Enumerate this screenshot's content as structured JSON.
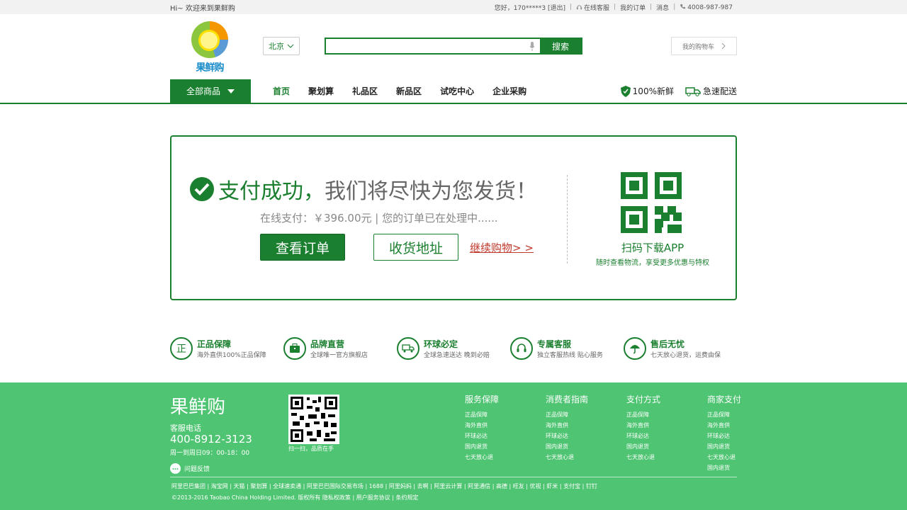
{
  "topbar": {
    "greeting": "Hi~ 欢迎来到果鲜购",
    "user": "您好，170*****3",
    "logout": "[退出]",
    "service": "在线客服",
    "orders": "我的订单",
    "messages": "消息",
    "phone": "4008-987-987"
  },
  "header": {
    "logo_text": "果鲜购",
    "city": "北京",
    "search_placeholder": "",
    "search_button": "搜索",
    "cart": "我的购物车"
  },
  "nav": {
    "all_categories": "全部商品",
    "links": [
      "首页",
      "聚划算",
      "礼品区",
      "新品区",
      "试吃中心",
      "企业采购"
    ],
    "badges": [
      "100%新鲜",
      "急速配送"
    ]
  },
  "success": {
    "title_green": "支付成功，",
    "title_rest": "我们将尽快为您发货！",
    "pay_info": "在线支付：￥396.00元  |  您的订单已在处理中......",
    "view_order": "查看订单",
    "address": "收货地址",
    "continue": "继续购物> >",
    "qr_title": "扫码下载APP",
    "qr_sub": "随时查看物流，享受更多优惠与特权"
  },
  "guarantees": [
    {
      "icon": "genuine-icon",
      "glyph": "正",
      "title": "正品保障",
      "sub": "海外直供100%正品保障"
    },
    {
      "icon": "briefcase-icon",
      "glyph": "",
      "title": "品牌直营",
      "sub": "全球唯一官方旗舰店"
    },
    {
      "icon": "truck-icon",
      "glyph": "",
      "title": "环球必定",
      "sub": "全球急速送达  晚到必赔"
    },
    {
      "icon": "headset-icon",
      "glyph": "",
      "title": "专属客服",
      "sub": "独立客服热线  贴心服务"
    },
    {
      "icon": "umbrella-icon",
      "glyph": "",
      "title": "售后无忧",
      "sub": "七天放心退货，运费由保"
    }
  ],
  "footer": {
    "brand": "果鲜购",
    "hotline_label": "客服电话",
    "hotline": "400-8912-3123",
    "hours": "周一到周日09：00-18：00",
    "feedback": "问题反馈",
    "qr_caption": "扫一扫，品质在手",
    "columns": [
      {
        "title": "服务保障",
        "items": [
          "正品保障",
          "海外直供",
          "环球必达",
          "国内退货",
          "七天放心退"
        ]
      },
      {
        "title": "消费者指南",
        "items": [
          "正品保障",
          "海外直供",
          "环球必达",
          "国内退货",
          "七天放心退"
        ]
      },
      {
        "title": "支付方式",
        "items": [
          "正品保障",
          "海外直供",
          "环球必达",
          "国内退货",
          "七天放心退"
        ]
      },
      {
        "title": "商家支付",
        "items": [
          "正品保障",
          "海外直供",
          "环球必达",
          "国内退货",
          "七天放心退",
          "国内退货"
        ]
      }
    ],
    "links": "阿里巴巴集团 | 淘宝网 | 天猫 | 聚划算 | 全球速卖通 | 阿里巴巴国际交易市场 | 1688 | 阿里妈妈 | 去啊 | 阿里云计算 | 阿里通信 | 高德 | 旺友 | 优视 | 虾米 | 支付宝 | 钉钉",
    "copyright": "©2013-2016 Taobao China Holding Limited. 版权所有 隐私权政策 | 用户服务协议 | 条约规定"
  },
  "colors": {
    "brand_green": "#1a7f2e",
    "footer_green": "#4fc472",
    "link_red": "#c0392b"
  }
}
